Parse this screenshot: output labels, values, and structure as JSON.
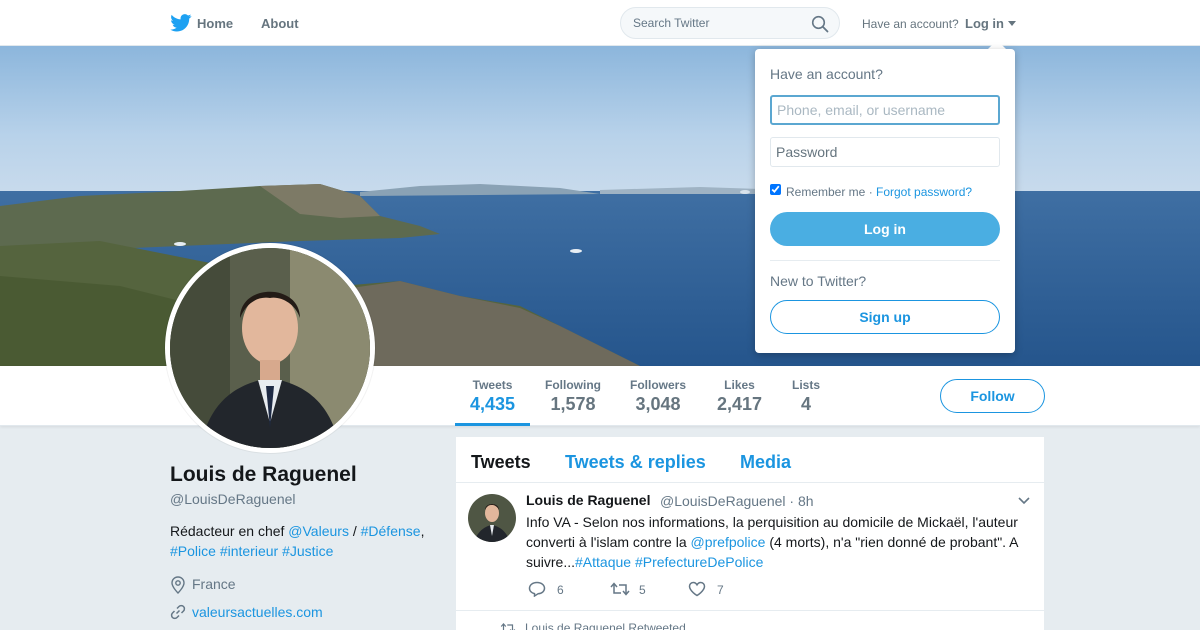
{
  "nav": {
    "home": "Home",
    "about": "About",
    "search_placeholder": "Search Twitter",
    "have_account": "Have an account?",
    "login": "Log in"
  },
  "profile": {
    "name": "Louis de Raguenel",
    "handle": "@LouisDeRaguenel",
    "bio_prefix": "Rédacteur en chef ",
    "bio_mention_valeurs": "@Valeurs",
    "bio_sep": " / ",
    "bio_tag_defense": "#Défense",
    "bio_comma": ",",
    "bio_tag_police": "#Police",
    "bio_tag_interieur": "#interieur",
    "bio_tag_justice": "#Justice",
    "location": "France",
    "website": "valeursactuelles.com"
  },
  "stats": [
    {
      "label": "Tweets",
      "value": "4,435"
    },
    {
      "label": "Following",
      "value": "1,578"
    },
    {
      "label": "Followers",
      "value": "3,048"
    },
    {
      "label": "Likes",
      "value": "2,417"
    },
    {
      "label": "Lists",
      "value": "4"
    }
  ],
  "follow_label": "Follow",
  "timeline": {
    "tabs": [
      "Tweets",
      "Tweets & replies",
      "Media"
    ],
    "tweet": {
      "name": "Louis de Raguenel",
      "handle": "@LouisDeRaguenel",
      "dot": "·",
      "time": "8h",
      "text_1": "Info VA - Selon nos informations, la perquisition au domicile de Mickaël, l'auteur converti à l'islam contre la ",
      "mention": "@prefpolice",
      "text_2": " (4 morts), n'a \"rien donné de probant\". A suivre...",
      "tag_attaque": "#Attaque",
      "tag_prefecture": "#PrefectureDePolice",
      "replies": "6",
      "retweets": "5",
      "likes": "7"
    },
    "retweet_note": "Louis de Raguenel Retweeted"
  },
  "login_dropdown": {
    "heading": "Have an account?",
    "username_placeholder": "Phone, email, or username",
    "password_placeholder": "Password",
    "remember": "Remember me ·",
    "forgot": "Forgot password?",
    "login_button": "Log in",
    "new_to": "New to Twitter?",
    "signup_button": "Sign up"
  },
  "colors": {
    "accent": "#1b95e0",
    "login_button": "#4aaee2",
    "page_bg": "#e6ecf0"
  }
}
